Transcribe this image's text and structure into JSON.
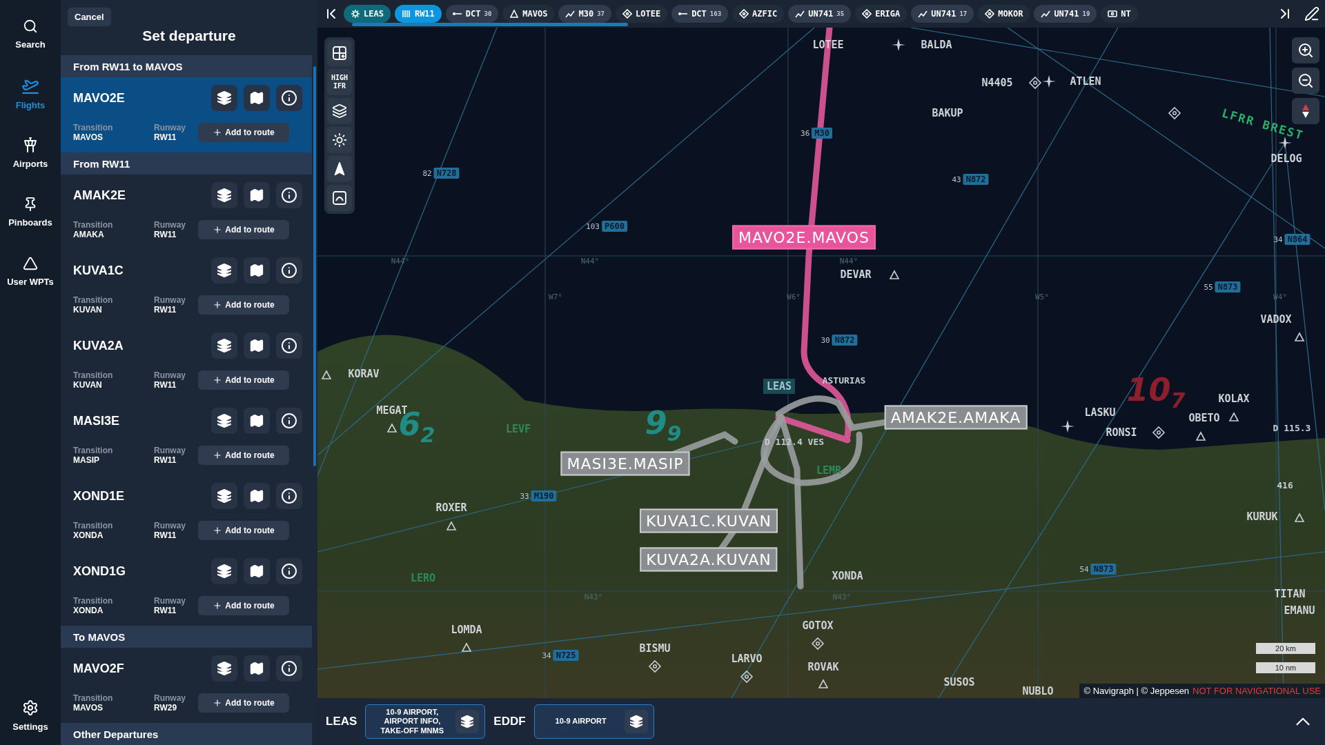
{
  "nav_rail": {
    "items": [
      {
        "kind": "search",
        "label": "Search",
        "selected": false
      },
      {
        "kind": "flights",
        "label": "Flights",
        "selected": true
      },
      {
        "kind": "airports",
        "label": "Airports",
        "selected": false
      },
      {
        "kind": "pinboards",
        "label": "Pinboards",
        "selected": false
      },
      {
        "kind": "waypoints",
        "label": "User WPTs",
        "selected": false
      }
    ],
    "settings": {
      "label": "Settings"
    }
  },
  "departure_panel": {
    "cancel": "Cancel",
    "title": "Set departure",
    "sections": [
      {
        "heading": "From RW11 to MAVOS",
        "procedures": [
          {
            "name": "MAVO2E",
            "transition_label": "Transition",
            "transition": "MAVOS",
            "runway_label": "Runway",
            "runway": "RW11",
            "add_label": "Add to route",
            "selected": true
          }
        ]
      },
      {
        "heading": "From RW11",
        "procedures": [
          {
            "name": "AMAK2E",
            "transition_label": "Transition",
            "transition": "AMAKA",
            "runway_label": "Runway",
            "runway": "RW11",
            "add_label": "Add to route",
            "selected": false
          },
          {
            "name": "KUVA1C",
            "transition_label": "Transition",
            "transition": "KUVAN",
            "runway_label": "Runway",
            "runway": "RW11",
            "add_label": "Add to route",
            "selected": false
          },
          {
            "name": "KUVA2A",
            "transition_label": "Transition",
            "transition": "KUVAN",
            "runway_label": "Runway",
            "runway": "RW11",
            "add_label": "Add to route",
            "selected": false
          },
          {
            "name": "MASI3E",
            "transition_label": "Transition",
            "transition": "MASIP",
            "runway_label": "Runway",
            "runway": "RW11",
            "add_label": "Add to route",
            "selected": false
          },
          {
            "name": "XOND1E",
            "transition_label": "Transition",
            "transition": "XONDA",
            "runway_label": "Runway",
            "runway": "RW11",
            "add_label": "Add to route",
            "selected": false
          },
          {
            "name": "XOND1G",
            "transition_label": "Transition",
            "transition": "XONDA",
            "runway_label": "Runway",
            "runway": "RW11",
            "add_label": "Add to route",
            "selected": false
          }
        ]
      },
      {
        "heading": "To MAVOS",
        "procedures": [
          {
            "name": "MAVO2F",
            "transition_label": "Transition",
            "transition": "MAVOS",
            "runway_label": "Runway",
            "runway": "RW29",
            "add_label": "Add to route",
            "selected": false
          }
        ]
      },
      {
        "heading": "Other Departures"
      }
    ]
  },
  "route_bar": {
    "items": [
      {
        "kind": "airport",
        "ident": "LEAS",
        "selected": true
      },
      {
        "kind": "runway",
        "ident": "RW11",
        "selected": true
      },
      {
        "kind": "direct",
        "ident": "DCT",
        "distance": "30",
        "selected": false
      },
      {
        "kind": "waypoint",
        "ident": "MAVOS",
        "selected": false
      },
      {
        "kind": "airway",
        "ident": "M30",
        "distance": "37",
        "selected": false
      },
      {
        "kind": "fix",
        "ident": "LOTEE",
        "selected": false
      },
      {
        "kind": "direct",
        "ident": "DCT",
        "distance": "163",
        "selected": false
      },
      {
        "kind": "fix",
        "ident": "AZFIC",
        "selected": false
      },
      {
        "kind": "airway",
        "ident": "UN741",
        "distance": "35",
        "selected": false
      },
      {
        "kind": "fix",
        "ident": "ERIGA",
        "selected": false
      },
      {
        "kind": "airway",
        "ident": "UN741",
        "distance": "17",
        "selected": false
      },
      {
        "kind": "fix",
        "ident": "MOKOR",
        "selected": false
      },
      {
        "kind": "airway",
        "ident": "UN741",
        "distance": "19",
        "selected": false
      },
      {
        "kind": "procedure",
        "ident": "NT",
        "selected": false
      }
    ]
  },
  "map": {
    "chart_type": "HIGH IFR",
    "grid_labels": [
      "N44°",
      "N44°",
      "N44°",
      "N43°",
      "N43°",
      "W7°",
      "W6°",
      "W5°",
      "W4°"
    ],
    "waypoints": [
      {
        "name": "LOTEE",
        "kind": "none"
      },
      {
        "name": "BALDA",
        "kind": "star"
      },
      {
        "name": "N4405",
        "kind": "diamond"
      },
      {
        "name": "ATLEN",
        "kind": "star"
      },
      {
        "name": "BAKUP",
        "kind": "diamond"
      },
      {
        "name": "DELOG",
        "kind": "star"
      },
      {
        "name": "DEVAR",
        "kind": "triangle"
      },
      {
        "name": "VADOX",
        "kind": "triangle"
      },
      {
        "name": "KORAV",
        "kind": "triangle"
      },
      {
        "name": "MEGAT",
        "kind": "triangle"
      },
      {
        "name": "LASKU",
        "kind": "star"
      },
      {
        "name": "RONSI",
        "kind": "diamond"
      },
      {
        "name": "OBETO",
        "kind": "triangle"
      },
      {
        "name": "KOLAX",
        "kind": "triangle"
      },
      {
        "name": "ROXER",
        "kind": "triangle"
      },
      {
        "name": "KURUK",
        "kind": "triangle"
      },
      {
        "name": "XONDA",
        "kind": "none"
      },
      {
        "name": "LOMDA",
        "kind": "triangle"
      },
      {
        "name": "GOTOX",
        "kind": "diamond"
      },
      {
        "name": "BISMU",
        "kind": "diamond"
      },
      {
        "name": "LARVO",
        "kind": "diamond"
      },
      {
        "name": "ROVAK",
        "kind": "triangle"
      },
      {
        "name": "SUSOS",
        "kind": "none"
      },
      {
        "name": "TITAN",
        "kind": "none"
      },
      {
        "name": "EMANU",
        "kind": "none"
      },
      {
        "name": "NUBLO",
        "kind": "none"
      }
    ],
    "airways": [
      {
        "ident": "N728",
        "distance": "82"
      },
      {
        "ident": "P600",
        "distance": "103"
      },
      {
        "ident": "M30",
        "distance": "36"
      },
      {
        "ident": "N872",
        "distance": "43"
      },
      {
        "ident": "N872",
        "distance": "30"
      },
      {
        "ident": "N864",
        "distance": "34"
      },
      {
        "ident": "N873",
        "distance": "55"
      },
      {
        "ident": "N873",
        "distance": "54"
      },
      {
        "ident": "M190",
        "distance": "33"
      },
      {
        "ident": "N725",
        "distance": "34"
      }
    ],
    "mora": [
      "6$_{2}$",
      "9$_{9}$",
      "10$_{7}$"
    ],
    "airports": [
      {
        "ident": "LEAS",
        "kind": "tag"
      },
      {
        "ident": "LEVF",
        "kind": "symbol"
      },
      {
        "ident": "LERO",
        "kind": "symbol"
      },
      {
        "ident": "LEMR",
        "kind": "symbol"
      }
    ],
    "navaids": [
      "ASTURIAS",
      "D 112.4 VES",
      "D 115.3",
      "416"
    ],
    "region": "LFRR BREST",
    "procedure_labels": [
      {
        "text": "MAVO2E.MAVOS",
        "selected": true
      },
      {
        "text": "AMAK2E.AMAKA",
        "selected": false
      },
      {
        "text": "MASI3E.MASIP",
        "selected": false
      },
      {
        "text": "KUVA1C.KUVAN",
        "selected": false
      },
      {
        "text": "KUVA2A.KUVAN",
        "selected": false
      }
    ],
    "scale": [
      "20 km",
      "10 nm"
    ],
    "attribution": {
      "source": "© Navigraph | © Jeppesen",
      "warning": "NOT FOR NAVIGATIONAL USE"
    }
  },
  "chart_bar": {
    "airports": [
      {
        "code": "LEAS",
        "chart": "10-9 AIRPORT, AIRPORT INFO, TAKE-OFF MNMS"
      },
      {
        "code": "EDDF",
        "chart": "10-9 AIRPORT"
      }
    ]
  }
}
